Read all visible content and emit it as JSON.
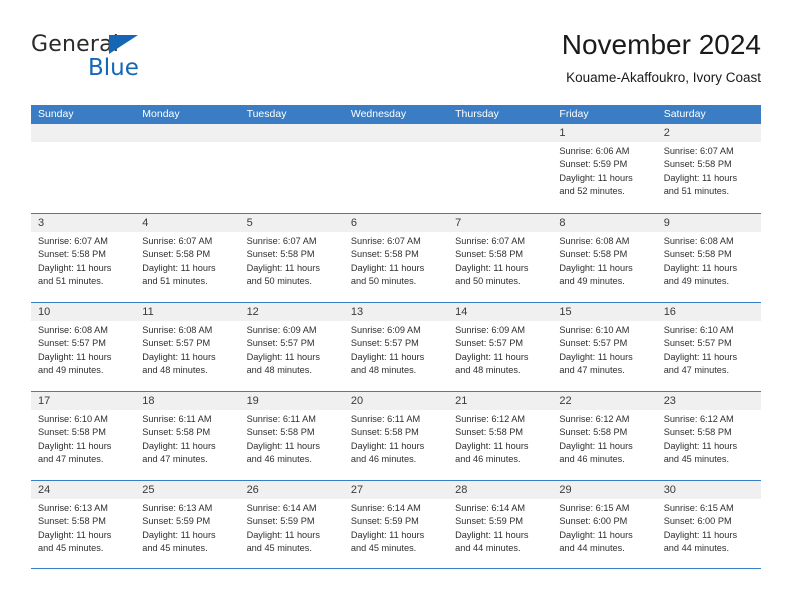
{
  "brand": {
    "word_one": "General",
    "word_two": "Blue",
    "triangle_icon": "blue-triangle-icon",
    "accent_color": "#1567b5"
  },
  "header": {
    "title": "November 2024",
    "subtitle": "Kouame-Akaffoukro, Ivory Coast"
  },
  "theme": {
    "header_blue": "#3b7dc4",
    "day_band_gray": "#f0f0f0",
    "text": "#2f2f2f"
  },
  "weekdays": [
    "Sunday",
    "Monday",
    "Tuesday",
    "Wednesday",
    "Thursday",
    "Friday",
    "Saturday"
  ],
  "weeks": [
    [
      {
        "day": "",
        "sunrise": "",
        "sunset": "",
        "daylight_1": "",
        "daylight_2": ""
      },
      {
        "day": "",
        "sunrise": "",
        "sunset": "",
        "daylight_1": "",
        "daylight_2": ""
      },
      {
        "day": "",
        "sunrise": "",
        "sunset": "",
        "daylight_1": "",
        "daylight_2": ""
      },
      {
        "day": "",
        "sunrise": "",
        "sunset": "",
        "daylight_1": "",
        "daylight_2": ""
      },
      {
        "day": "",
        "sunrise": "",
        "sunset": "",
        "daylight_1": "",
        "daylight_2": ""
      },
      {
        "day": "1",
        "sunrise": "Sunrise: 6:06 AM",
        "sunset": "Sunset: 5:59 PM",
        "daylight_1": "Daylight: 11 hours",
        "daylight_2": "and 52 minutes."
      },
      {
        "day": "2",
        "sunrise": "Sunrise: 6:07 AM",
        "sunset": "Sunset: 5:58 PM",
        "daylight_1": "Daylight: 11 hours",
        "daylight_2": "and 51 minutes."
      }
    ],
    [
      {
        "day": "3",
        "sunrise": "Sunrise: 6:07 AM",
        "sunset": "Sunset: 5:58 PM",
        "daylight_1": "Daylight: 11 hours",
        "daylight_2": "and 51 minutes."
      },
      {
        "day": "4",
        "sunrise": "Sunrise: 6:07 AM",
        "sunset": "Sunset: 5:58 PM",
        "daylight_1": "Daylight: 11 hours",
        "daylight_2": "and 51 minutes."
      },
      {
        "day": "5",
        "sunrise": "Sunrise: 6:07 AM",
        "sunset": "Sunset: 5:58 PM",
        "daylight_1": "Daylight: 11 hours",
        "daylight_2": "and 50 minutes."
      },
      {
        "day": "6",
        "sunrise": "Sunrise: 6:07 AM",
        "sunset": "Sunset: 5:58 PM",
        "daylight_1": "Daylight: 11 hours",
        "daylight_2": "and 50 minutes."
      },
      {
        "day": "7",
        "sunrise": "Sunrise: 6:07 AM",
        "sunset": "Sunset: 5:58 PM",
        "daylight_1": "Daylight: 11 hours",
        "daylight_2": "and 50 minutes."
      },
      {
        "day": "8",
        "sunrise": "Sunrise: 6:08 AM",
        "sunset": "Sunset: 5:58 PM",
        "daylight_1": "Daylight: 11 hours",
        "daylight_2": "and 49 minutes."
      },
      {
        "day": "9",
        "sunrise": "Sunrise: 6:08 AM",
        "sunset": "Sunset: 5:58 PM",
        "daylight_1": "Daylight: 11 hours",
        "daylight_2": "and 49 minutes."
      }
    ],
    [
      {
        "day": "10",
        "sunrise": "Sunrise: 6:08 AM",
        "sunset": "Sunset: 5:57 PM",
        "daylight_1": "Daylight: 11 hours",
        "daylight_2": "and 49 minutes."
      },
      {
        "day": "11",
        "sunrise": "Sunrise: 6:08 AM",
        "sunset": "Sunset: 5:57 PM",
        "daylight_1": "Daylight: 11 hours",
        "daylight_2": "and 48 minutes."
      },
      {
        "day": "12",
        "sunrise": "Sunrise: 6:09 AM",
        "sunset": "Sunset: 5:57 PM",
        "daylight_1": "Daylight: 11 hours",
        "daylight_2": "and 48 minutes."
      },
      {
        "day": "13",
        "sunrise": "Sunrise: 6:09 AM",
        "sunset": "Sunset: 5:57 PM",
        "daylight_1": "Daylight: 11 hours",
        "daylight_2": "and 48 minutes."
      },
      {
        "day": "14",
        "sunrise": "Sunrise: 6:09 AM",
        "sunset": "Sunset: 5:57 PM",
        "daylight_1": "Daylight: 11 hours",
        "daylight_2": "and 48 minutes."
      },
      {
        "day": "15",
        "sunrise": "Sunrise: 6:10 AM",
        "sunset": "Sunset: 5:57 PM",
        "daylight_1": "Daylight: 11 hours",
        "daylight_2": "and 47 minutes."
      },
      {
        "day": "16",
        "sunrise": "Sunrise: 6:10 AM",
        "sunset": "Sunset: 5:57 PM",
        "daylight_1": "Daylight: 11 hours",
        "daylight_2": "and 47 minutes."
      }
    ],
    [
      {
        "day": "17",
        "sunrise": "Sunrise: 6:10 AM",
        "sunset": "Sunset: 5:58 PM",
        "daylight_1": "Daylight: 11 hours",
        "daylight_2": "and 47 minutes."
      },
      {
        "day": "18",
        "sunrise": "Sunrise: 6:11 AM",
        "sunset": "Sunset: 5:58 PM",
        "daylight_1": "Daylight: 11 hours",
        "daylight_2": "and 47 minutes."
      },
      {
        "day": "19",
        "sunrise": "Sunrise: 6:11 AM",
        "sunset": "Sunset: 5:58 PM",
        "daylight_1": "Daylight: 11 hours",
        "daylight_2": "and 46 minutes."
      },
      {
        "day": "20",
        "sunrise": "Sunrise: 6:11 AM",
        "sunset": "Sunset: 5:58 PM",
        "daylight_1": "Daylight: 11 hours",
        "daylight_2": "and 46 minutes."
      },
      {
        "day": "21",
        "sunrise": "Sunrise: 6:12 AM",
        "sunset": "Sunset: 5:58 PM",
        "daylight_1": "Daylight: 11 hours",
        "daylight_2": "and 46 minutes."
      },
      {
        "day": "22",
        "sunrise": "Sunrise: 6:12 AM",
        "sunset": "Sunset: 5:58 PM",
        "daylight_1": "Daylight: 11 hours",
        "daylight_2": "and 46 minutes."
      },
      {
        "day": "23",
        "sunrise": "Sunrise: 6:12 AM",
        "sunset": "Sunset: 5:58 PM",
        "daylight_1": "Daylight: 11 hours",
        "daylight_2": "and 45 minutes."
      }
    ],
    [
      {
        "day": "24",
        "sunrise": "Sunrise: 6:13 AM",
        "sunset": "Sunset: 5:58 PM",
        "daylight_1": "Daylight: 11 hours",
        "daylight_2": "and 45 minutes."
      },
      {
        "day": "25",
        "sunrise": "Sunrise: 6:13 AM",
        "sunset": "Sunset: 5:59 PM",
        "daylight_1": "Daylight: 11 hours",
        "daylight_2": "and 45 minutes."
      },
      {
        "day": "26",
        "sunrise": "Sunrise: 6:14 AM",
        "sunset": "Sunset: 5:59 PM",
        "daylight_1": "Daylight: 11 hours",
        "daylight_2": "and 45 minutes."
      },
      {
        "day": "27",
        "sunrise": "Sunrise: 6:14 AM",
        "sunset": "Sunset: 5:59 PM",
        "daylight_1": "Daylight: 11 hours",
        "daylight_2": "and 45 minutes."
      },
      {
        "day": "28",
        "sunrise": "Sunrise: 6:14 AM",
        "sunset": "Sunset: 5:59 PM",
        "daylight_1": "Daylight: 11 hours",
        "daylight_2": "and 44 minutes."
      },
      {
        "day": "29",
        "sunrise": "Sunrise: 6:15 AM",
        "sunset": "Sunset: 6:00 PM",
        "daylight_1": "Daylight: 11 hours",
        "daylight_2": "and 44 minutes."
      },
      {
        "day": "30",
        "sunrise": "Sunrise: 6:15 AM",
        "sunset": "Sunset: 6:00 PM",
        "daylight_1": "Daylight: 11 hours",
        "daylight_2": "and 44 minutes."
      }
    ]
  ]
}
